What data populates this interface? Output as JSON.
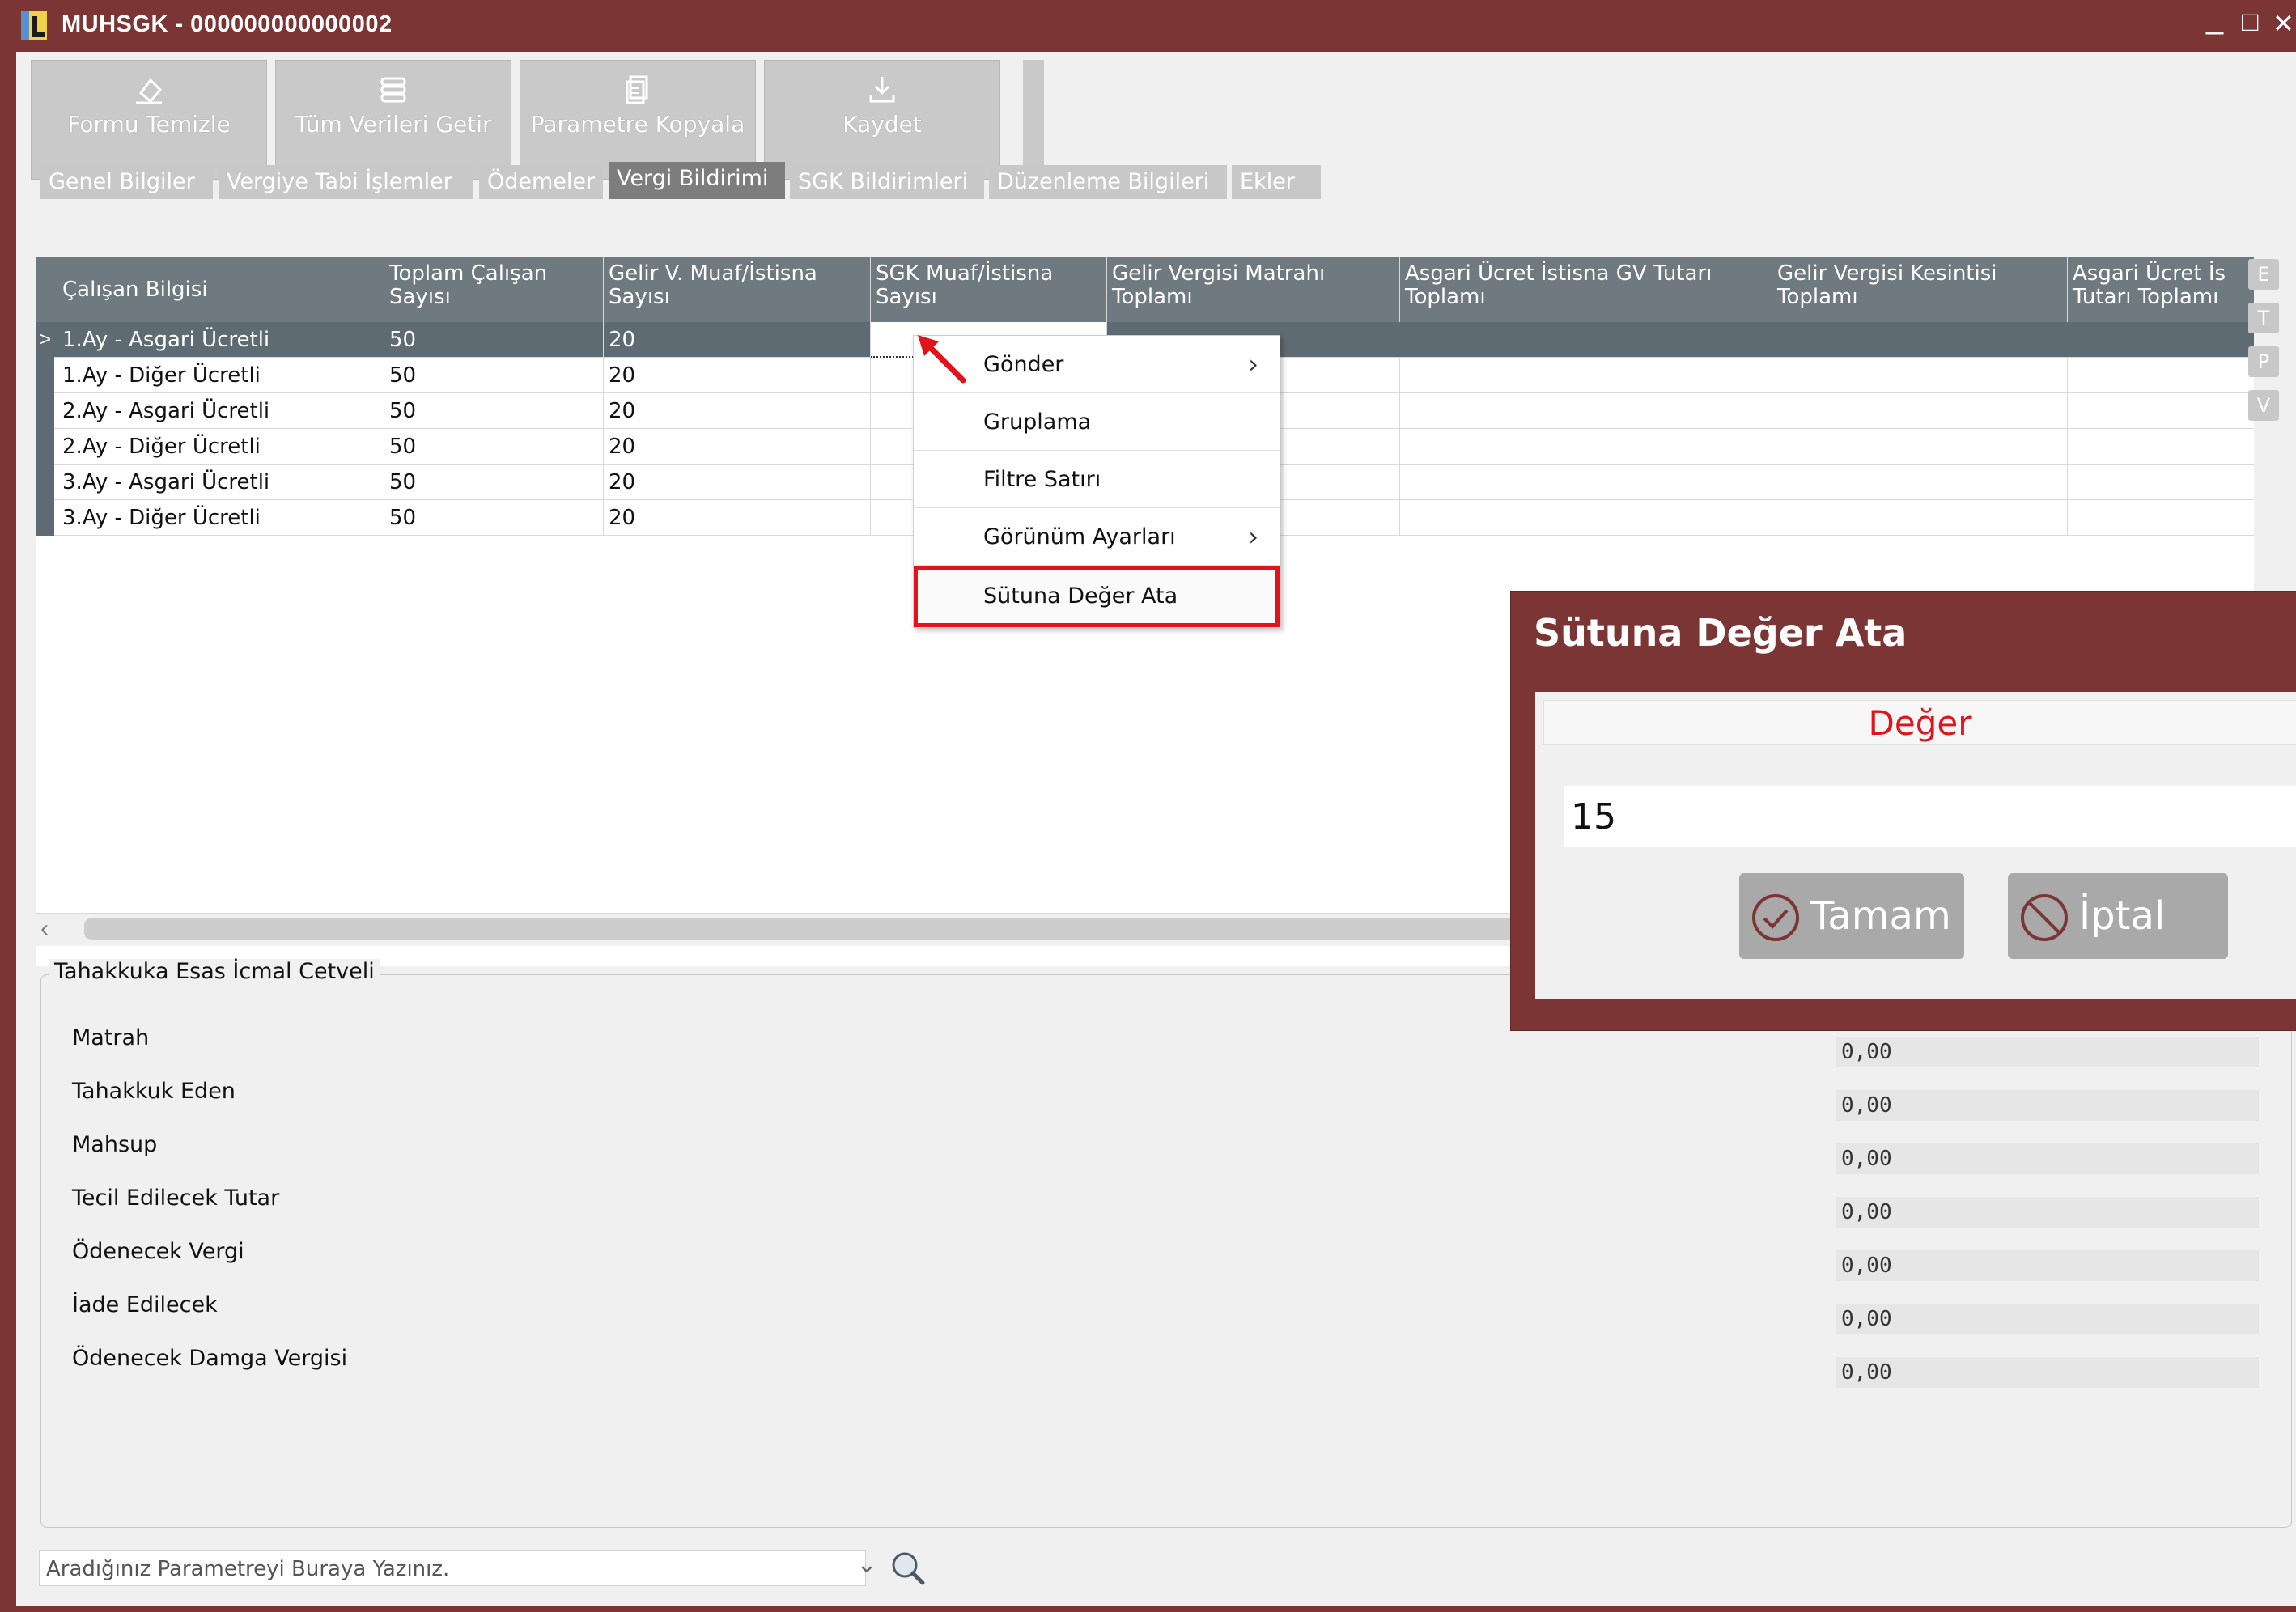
{
  "window": {
    "title": "MUHSGK - 000000000000002",
    "controls": {
      "minimize": "_",
      "maximize": "□",
      "close": "✕"
    }
  },
  "toolbar": {
    "buttons": [
      {
        "label": "Formu Temizle",
        "icon": "eraser-icon"
      },
      {
        "label": "Tüm Verileri Getir",
        "icon": "stack-icon"
      },
      {
        "label": "Parametre Kopyala",
        "icon": "copy-icon"
      },
      {
        "label": "Kaydet",
        "icon": "download-icon"
      }
    ]
  },
  "tabs": [
    {
      "label": "Genel Bilgiler",
      "active": false
    },
    {
      "label": "Vergiye Tabi İşlemler",
      "active": false
    },
    {
      "label": "Ödemeler",
      "active": false
    },
    {
      "label": "Vergi Bildirimi",
      "active": true
    },
    {
      "label": "SGK Bildirimleri",
      "active": false
    },
    {
      "label": "Düzenleme Bilgileri",
      "active": false
    },
    {
      "label": "Ekler",
      "active": false
    }
  ],
  "grid": {
    "columns": [
      "Çalışan Bilgisi",
      "Toplam Çalışan Sayısı",
      "Gelir V. Muaf/İstisna Sayısı",
      "SGK Muaf/İstisna Sayısı",
      "Gelir Vergisi Matrahı Toplamı",
      "Asgari Ücret İstisna GV Tutarı Toplamı",
      "Gelir Vergisi Kesintisi Toplamı",
      "Asgari Ücret İs Tutarı Toplamı"
    ],
    "rows": [
      [
        "1.Ay - Asgari Ücretli",
        "50",
        "20"
      ],
      [
        "1.Ay - Diğer Ücretli",
        "50",
        "20"
      ],
      [
        "2.Ay - Asgari Ücretli",
        "50",
        "20"
      ],
      [
        "2.Ay - Diğer Ücretli",
        "50",
        "20"
      ],
      [
        "3.Ay - Asgari Ücretli",
        "50",
        "20"
      ],
      [
        "3.Ay - Diğer Ücretli",
        "50",
        "20"
      ]
    ],
    "selected_row_indicator": ">",
    "side_buttons": [
      "E",
      "T",
      "P",
      "V"
    ]
  },
  "context_menu": {
    "items": [
      {
        "label": "Gönder",
        "has_submenu": true
      },
      {
        "label": "Gruplama",
        "has_submenu": false
      },
      {
        "label": "Filtre Satırı",
        "has_submenu": false
      },
      {
        "label": "Görünüm Ayarları",
        "has_submenu": true
      },
      {
        "label": "Sütuna Değer Ata",
        "has_submenu": false,
        "highlighted": true
      }
    ],
    "submenu_glyph": "›"
  },
  "summary": {
    "title": "Tahakkuka Esas İcmal Cetveli",
    "items": [
      {
        "label": "Matrah",
        "value": "0,00"
      },
      {
        "label": "Tahakkuk Eden",
        "value": "0,00"
      },
      {
        "label": "Mahsup",
        "value": "0,00"
      },
      {
        "label": "Tecil Edilecek Tutar",
        "value": "0,00"
      },
      {
        "label": "Ödenecek Vergi",
        "value": "0,00"
      },
      {
        "label": "İade Edilecek",
        "value": "0,00"
      },
      {
        "label": "Ödenecek Damga Vergisi",
        "value": "0,00"
      }
    ]
  },
  "search": {
    "placeholder": "Aradığınız Parametreyi Buraya Yazınız.",
    "chevron": "⌄"
  },
  "dialog": {
    "title": "Sütuna Değer Ata",
    "caption": "Değer",
    "value": "15",
    "ok_label": "Tamam",
    "cancel_label": "İptal"
  },
  "colors": {
    "frame": "#7b3535",
    "grid_header": "#6f7a80",
    "highlight_red": "#e0141a"
  }
}
